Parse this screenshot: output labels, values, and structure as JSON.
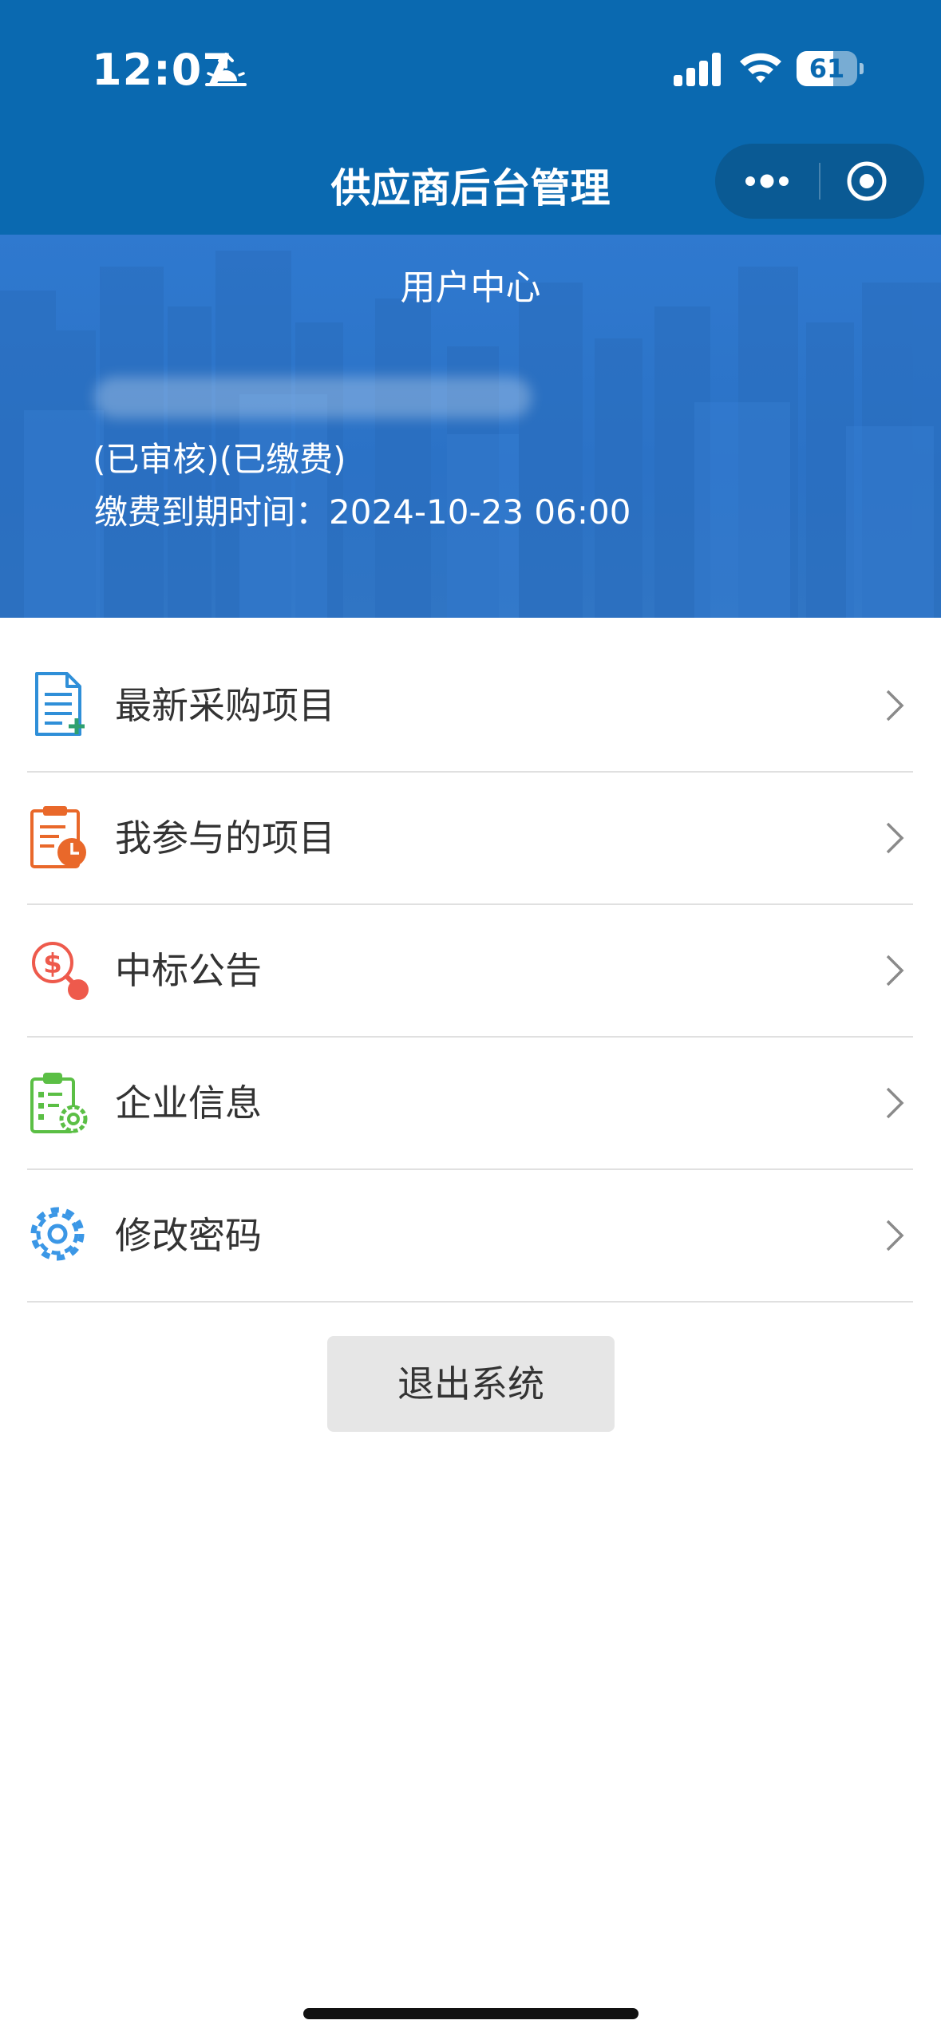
{
  "status_bar": {
    "time": "12:07",
    "battery_level": "61",
    "battery_fraction": 0.61,
    "icons": [
      "sunrise-icon",
      "signal-icon",
      "wifi-icon",
      "battery-icon"
    ]
  },
  "nav": {
    "title": "供应商后台管理",
    "capsule_icons": [
      "more-icon",
      "close-target-icon"
    ]
  },
  "hero": {
    "title": "用户中心",
    "status": "(已审核)(已缴费)",
    "expiry": "缴费到期时间：2024-10-23 06:00"
  },
  "menu": {
    "items": [
      {
        "label": "最新采购项目",
        "icon": "document-add-icon",
        "color": "#2f8fd8"
      },
      {
        "label": "我参与的项目",
        "icon": "clipboard-clock-icon",
        "color": "#e9682a"
      },
      {
        "label": "中标公告",
        "icon": "dollar-search-icon",
        "color": "#ee5a4c"
      },
      {
        "label": "企业信息",
        "icon": "clipboard-gear-icon",
        "color": "#5bbf45"
      },
      {
        "label": "修改密码",
        "icon": "gear-icon",
        "color": "#3b97e6"
      }
    ]
  },
  "logout": {
    "label": "退出系统"
  },
  "colors": {
    "header_bg": "#0a69b0",
    "hero_bg": "#2f79cf"
  }
}
